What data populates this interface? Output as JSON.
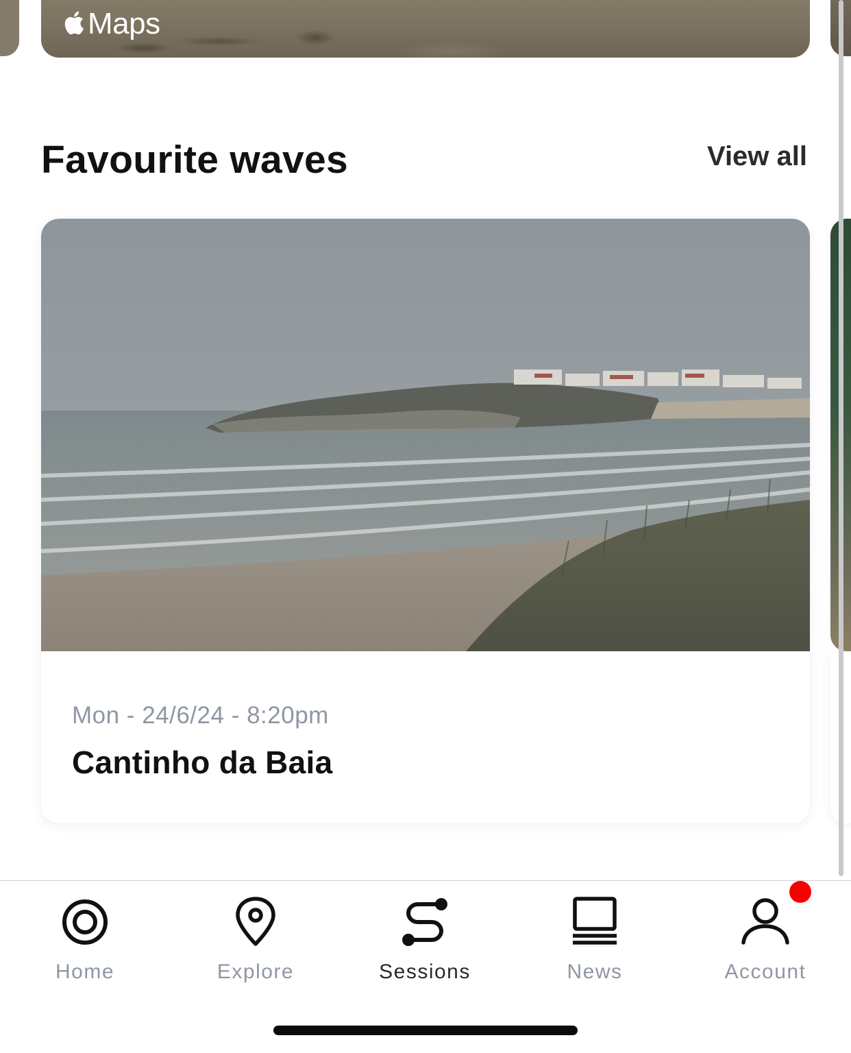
{
  "map_card": {
    "badge_text": "Maps"
  },
  "favourites": {
    "title": "Favourite waves",
    "view_all_label": "View all",
    "cards": [
      {
        "date": "Mon - 24/6/24 - 8:20pm",
        "spot": "Cantinho da Baia"
      }
    ]
  },
  "tabbar": {
    "tabs": [
      {
        "label": "Home",
        "icon": "target-icon"
      },
      {
        "label": "Explore",
        "icon": "map-pin-icon"
      },
      {
        "label": "Sessions",
        "icon": "route-icon",
        "active": true
      },
      {
        "label": "News",
        "icon": "laptop-icon"
      },
      {
        "label": "Account",
        "icon": "user-icon",
        "has_notification": true
      }
    ]
  },
  "colors": {
    "accent_text": "#111111",
    "muted_text": "#8e97a3",
    "notification": "#f70000"
  }
}
